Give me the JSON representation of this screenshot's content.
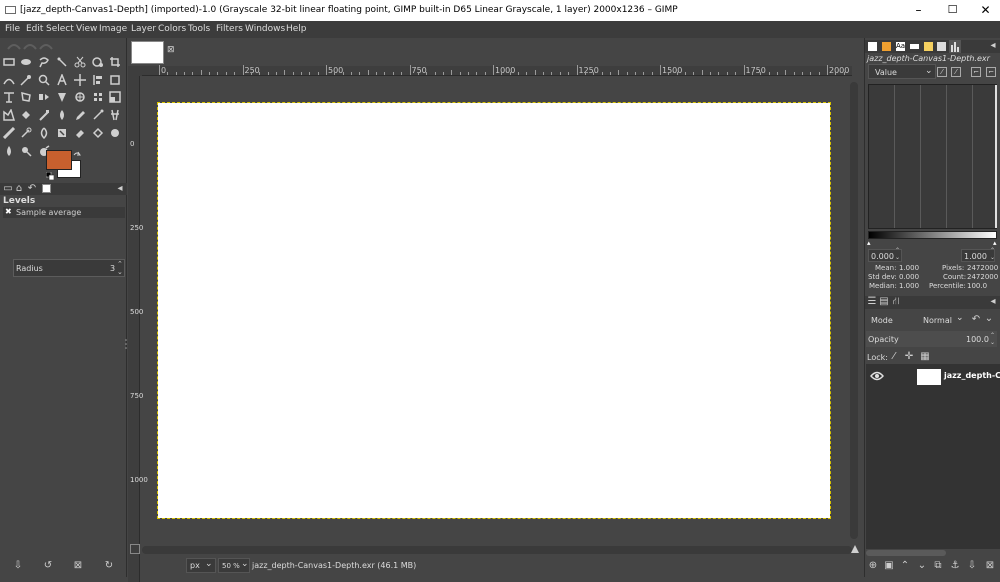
{
  "window": {
    "title": "[jazz_depth-Canvas1-Depth] (imported)-1.0 (Grayscale 32-bit linear floating point, GIMP built-in D65 Linear Grayscale, 1 layer) 2000x1236 – GIMP",
    "minimize": "–",
    "maximize": "☐",
    "close": "✕"
  },
  "menu": {
    "items": [
      "File",
      "Edit",
      "Select",
      "View",
      "Image",
      "Layer",
      "Colors",
      "Tools",
      "Filters",
      "Windows",
      "Help"
    ]
  },
  "colors": {
    "foreground": "#c8602e",
    "background": "#ffffff",
    "accent": "#0078d7"
  },
  "tool_options": {
    "title": "Levels",
    "sample_average_label": "Sample average",
    "radius_label": "Radius",
    "radius_value": "3"
  },
  "ruler": {
    "labels": [
      "0",
      "250",
      "500",
      "750",
      "1000",
      "1250",
      "1500",
      "1750",
      "2000"
    ]
  },
  "image_tab": {
    "close": "⊠"
  },
  "statusbar": {
    "unit": "px",
    "zoom": "50 %",
    "file_info": "jazz_depth-Canvas1-Depth.exr (46.1 MB)"
  },
  "histogram": {
    "image_name": "jazz_depth-Canvas1-Depth.exr",
    "channel": "Value",
    "range_low": "0.000",
    "range_high": "1.000",
    "mean_label": "Mean:",
    "mean_value": "1.000",
    "stddev_label": "Std dev:",
    "stddev_value": "0.000",
    "median_label": "Median:",
    "median_value": "1.000",
    "pixels_label": "Pixels:",
    "pixels_value": "2472000",
    "count_label": "Count:",
    "count_value": "2472000",
    "percentile_label": "Percentile:",
    "percentile_value": "100.0"
  },
  "layers": {
    "mode_label": "Mode",
    "mode_value": "Normal",
    "opacity_label": "Opacity",
    "opacity_value": "100.0",
    "lock_label": "Lock:",
    "layer_name": "jazz_depth-C"
  }
}
